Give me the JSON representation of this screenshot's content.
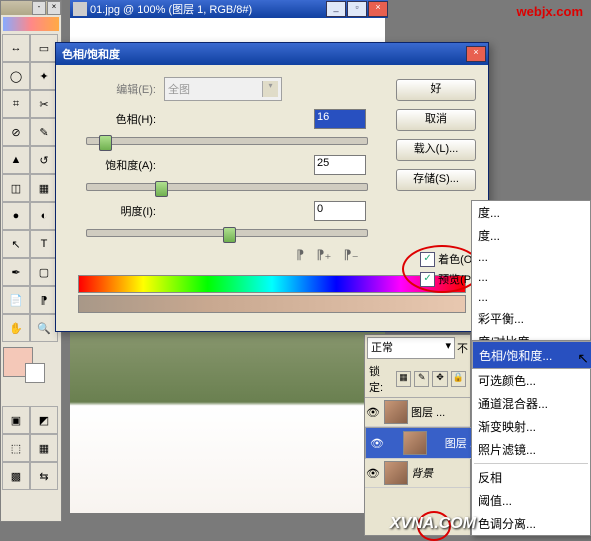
{
  "watermark1": "webjx.com",
  "watermark2": "XVNA.COM",
  "doc": {
    "title": "01.jpg @ 100% (图层 1, RGB/8#)"
  },
  "dialog": {
    "title": "色相/饱和度",
    "edit_label": "编辑(E):",
    "edit_value": "全图",
    "hue_label": "色相(H):",
    "hue_value": "16",
    "sat_label": "饱和度(A):",
    "sat_value": "25",
    "light_label": "明度(I):",
    "light_value": "0",
    "colorize_label": "着色(O)",
    "preview_label": "预览(P)",
    "ok": "好",
    "cancel": "取消",
    "load": "载入(L)...",
    "save": "存储(S)..."
  },
  "layers": {
    "blend": "正常",
    "opacity_label": "不",
    "lock": "锁定:",
    "items": [
      {
        "name": "图层 ..."
      },
      {
        "name": "图层 ..."
      },
      {
        "name": "背景"
      }
    ]
  },
  "menu_top": [
    "度...",
    "度...",
    "...",
    "...",
    "...",
    "彩平衡...",
    "度/对比度..."
  ],
  "menu": [
    "色相/饱和度...",
    "可选颜色...",
    "通道混合器...",
    "渐变映射...",
    "照片滤镜...",
    "|",
    "反相",
    "阈值...",
    "色调分离..."
  ]
}
